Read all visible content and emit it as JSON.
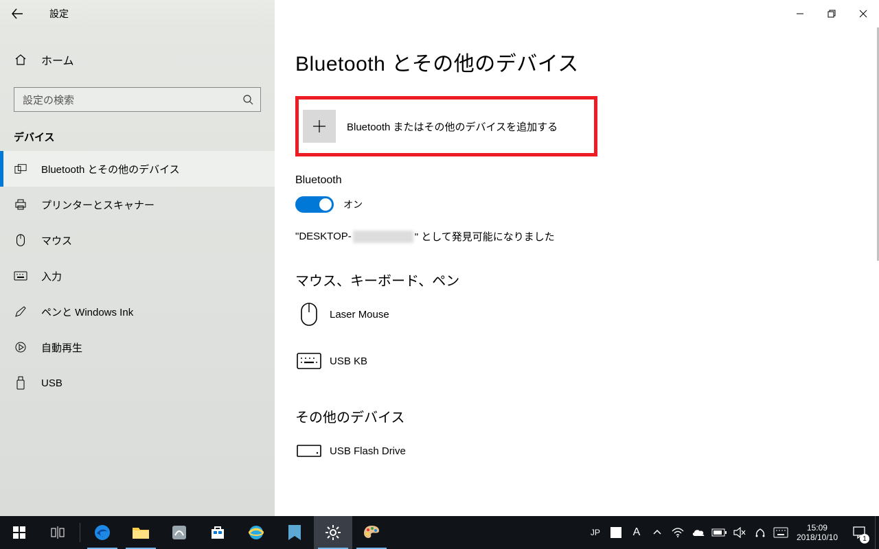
{
  "window": {
    "title": "設定",
    "back": "戻る",
    "controls": {
      "minimize": "最小化",
      "maximize": "元に戻す",
      "close": "閉じる"
    }
  },
  "sidebar": {
    "home": "ホーム",
    "search_placeholder": "設定の検索",
    "category": "デバイス",
    "items": [
      {
        "label": "Bluetooth とその他のデバイス",
        "icon": "device",
        "selected": true
      },
      {
        "label": "プリンターとスキャナー",
        "icon": "printer",
        "selected": false
      },
      {
        "label": "マウス",
        "icon": "mouse",
        "selected": false
      },
      {
        "label": "入力",
        "icon": "keyboard",
        "selected": false
      },
      {
        "label": "ペンと Windows Ink",
        "icon": "pen",
        "selected": false
      },
      {
        "label": "自動再生",
        "icon": "autoplay",
        "selected": false
      },
      {
        "label": "USB",
        "icon": "usb",
        "selected": false
      }
    ]
  },
  "main": {
    "heading": "Bluetooth とその他のデバイス",
    "add_device": "Bluetooth またはその他のデバイスを追加する",
    "bluetooth": {
      "label": "Bluetooth",
      "state_text": "オン",
      "on": true,
      "discover_prefix": "\"DESKTOP-",
      "discover_suffix": "\" として発見可能になりました"
    },
    "sections": {
      "mkp": {
        "title": "マウス、キーボード、ペン",
        "devices": [
          {
            "name": "Laser Mouse",
            "icon": "mouse"
          },
          {
            "name": "USB KB",
            "icon": "keyboard"
          }
        ]
      },
      "other": {
        "title": "その他のデバイス",
        "devices": [
          {
            "name": "USB Flash Drive",
            "icon": "drive"
          }
        ]
      }
    }
  },
  "taskbar": {
    "ime_lang": "JP",
    "ime_mode": "A",
    "clock": {
      "time": "15:09",
      "date": "2018/10/10"
    },
    "action_center_badge": "1"
  }
}
